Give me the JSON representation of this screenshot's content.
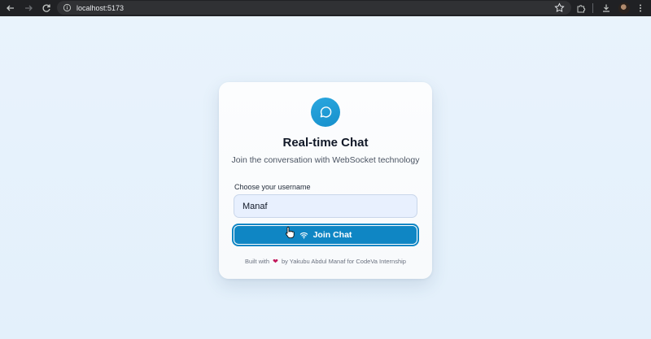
{
  "browser": {
    "url": "localhost:5173"
  },
  "card": {
    "title": "Real-time Chat",
    "subtitle": "Join the conversation with WebSocket technology",
    "username_label": "Choose your username",
    "username_value": "Manaf",
    "join_label": "Join Chat",
    "footer_prefix": "Built with",
    "footer_suffix": "by Yakubu Abdul Manaf for CodeVa Internship"
  },
  "icons": {
    "logo": "message-circle-icon",
    "join": "wifi-icon",
    "footer": "heart-icon"
  },
  "colors": {
    "accent": "#0f86c4",
    "logo_bg": "#1f9ad3",
    "browser_bar": "#202124"
  }
}
